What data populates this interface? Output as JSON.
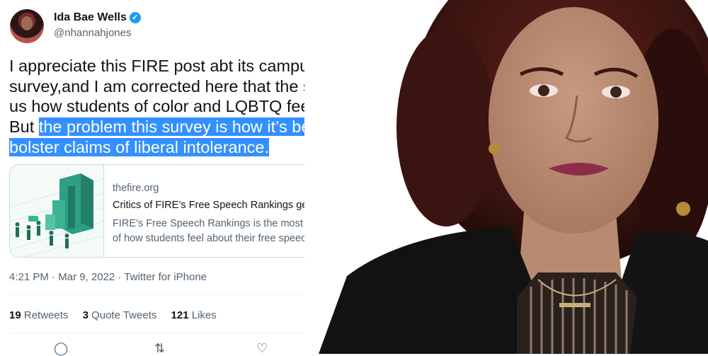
{
  "tweet": {
    "display_name": "Ida Bae Wells",
    "handle": "@nhannahjones",
    "text_before": "I appreciate this FIRE post abt its campus climate survey,and I am corrected here that the survey does tell us how students of color and LQBTQ feel in this survey. But ",
    "text_highlighted": "the problem this survey is how it’s being used to bolster claims of liberal intolerance.",
    "card": {
      "domain": "thefire.org",
      "title": "Critics of FIRE’s Free Speech Rankings get it wrong — again.",
      "description": "FIRE’s Free Speech Rankings is the most comprehensive survey of how students feel about their free speech rights o..."
    },
    "meta": "4:21 PM · Mar 9, 2022 · Twitter for iPhone",
    "stats": {
      "retweets_count": "19",
      "retweets_label": "Retweets",
      "quotes_count": "3",
      "quotes_label": "Quote Tweets",
      "likes_count": "121",
      "likes_label": "Likes"
    }
  },
  "colors": {
    "verified": "#1d9bf0",
    "highlight": "#3390ff",
    "secondary_text": "#536471"
  },
  "icons": [
    "verified-badge-icon",
    "more-options-icon",
    "reply-icon",
    "retweet-icon",
    "like-icon"
  ]
}
